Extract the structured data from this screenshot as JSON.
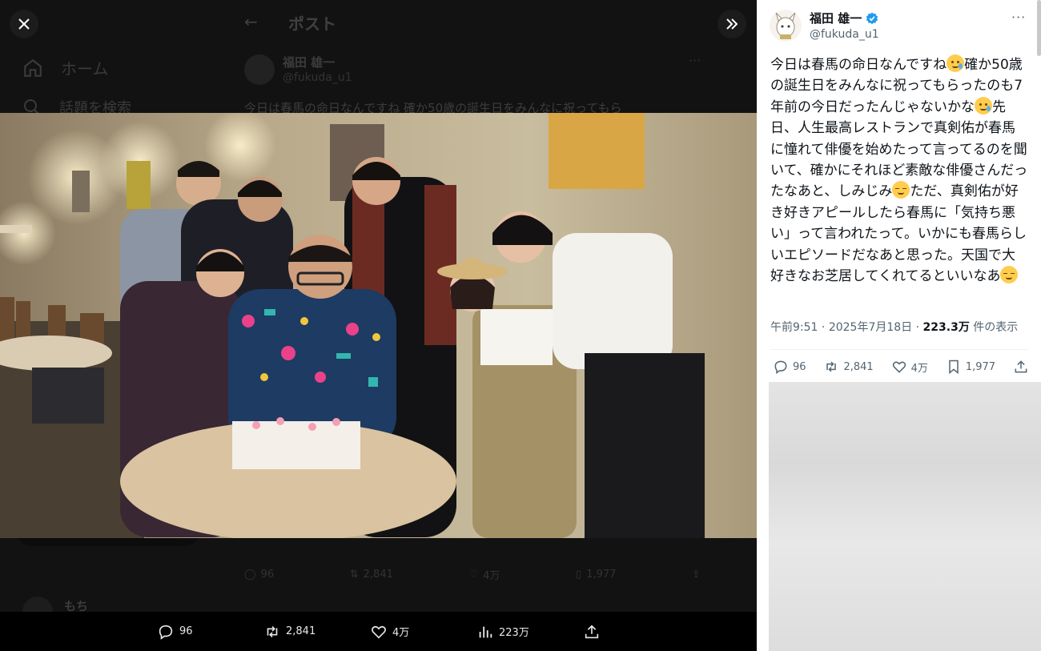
{
  "underlying_page": {
    "nav_home": "ホーム",
    "nav_search": "話題を検索",
    "post_title": "ポスト",
    "author_name": "福田 雄一",
    "author_handle": "@fukuda_u1",
    "text_preview": "今日は春馬の命日なんですね 確か50歳の誕生日をみんなに祝ってもら",
    "replies": "96",
    "reposts": "2,841",
    "likes": "4万",
    "bookmarks": "1,977",
    "reply_author": "もち"
  },
  "overlay": {
    "close_icon": "close-icon",
    "expand_icon": "double-chevron-right-icon"
  },
  "bottom_bar": {
    "replies": "96",
    "reposts": "2,841",
    "likes": "4万",
    "views": "223万"
  },
  "tweet": {
    "author_name": "福田 雄一",
    "author_handle": "@fukuda_u1",
    "verified": true,
    "more_label": "···",
    "body_1": "今日は春馬の命日なんですね",
    "body_2": "確か50歳の誕生日をみんなに祝ってもらったのも7年前の今日だったんじゃないかな",
    "body_3": "先日、人生最高レストランで真剣佑が春馬に憧れて俳優を始めたって言ってるのを聞いて、確かにそれほど素敵な俳優さんだったなあと、しみじみ",
    "body_4": "ただ、真剣佑が好き好きアピールしたら春馬に「気持ち悪い」って言われたって。いかにも春馬らしいエピソードだなあと思った。天国で大好きなお芝居してくれてるといいなあ",
    "time": "午前9:51",
    "date": "2025年7月18日",
    "views": "223.3万",
    "views_label": "件の表示",
    "replies": "96",
    "reposts": "2,841",
    "likes": "4万",
    "bookmarks": "1,977",
    "accent_color": "#1d9bf0"
  }
}
